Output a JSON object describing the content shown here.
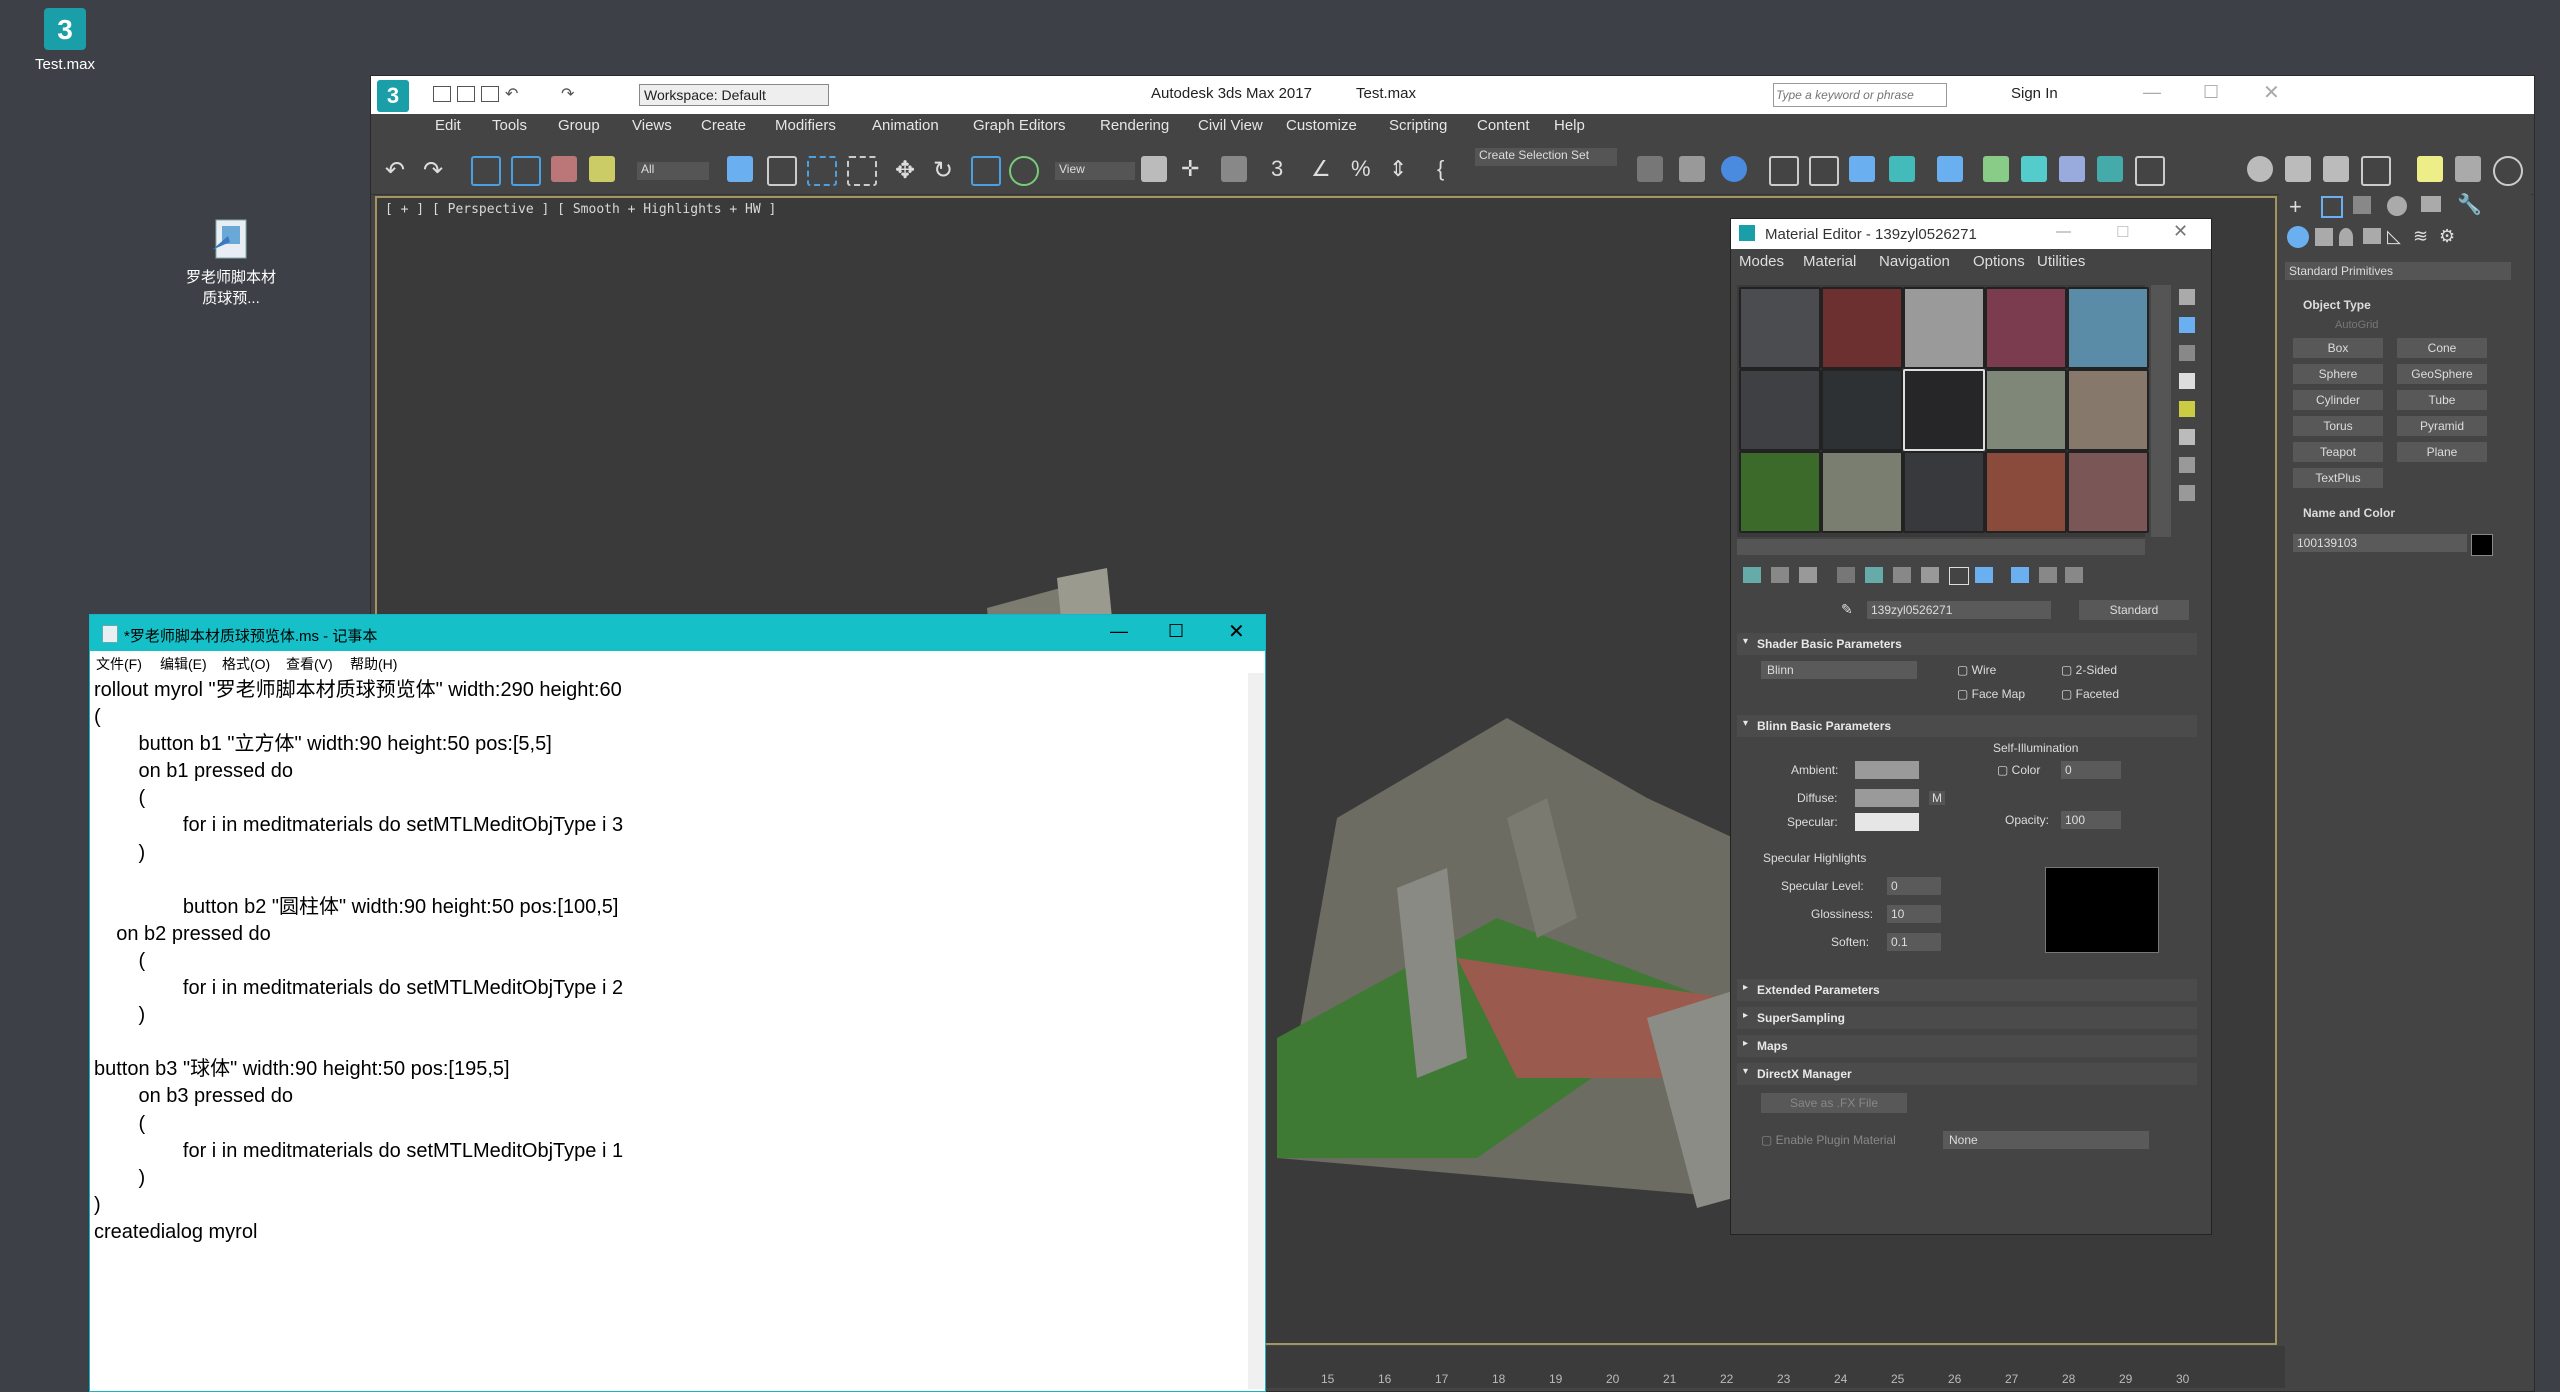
{
  "desktop": {
    "icons": [
      {
        "label": "Test.max"
      },
      {
        "label": "罗老师脚本材质球预..."
      }
    ]
  },
  "max_window": {
    "app_title": "Autodesk 3ds Max 2017",
    "file_name": "Test.max",
    "workspace": "Workspace: Default",
    "search_placeholder": "Type a keyword or phrase",
    "sign_in": "Sign In",
    "menu": [
      "Edit",
      "Tools",
      "Group",
      "Views",
      "Create",
      "Modifiers",
      "Animation",
      "Graph Editors",
      "Rendering",
      "Civil View",
      "Customize",
      "Scripting",
      "Content",
      "Help"
    ],
    "filter_dropdown": "All",
    "view_dropdown": "View",
    "selection_set": "Create Selection Set",
    "viewport_label": "[ + ] [ Perspective ] [ Smooth + Highlights + HW ]",
    "timeline_ticks": [
      "15",
      "16",
      "17",
      "18",
      "19",
      "20",
      "21",
      "22",
      "23",
      "24",
      "25",
      "26",
      "27",
      "28",
      "29",
      "30"
    ]
  },
  "command_panel": {
    "category": "Standard Primitives",
    "object_type_title": "Object Type",
    "autogrid": "AutoGrid",
    "buttons": [
      "Box",
      "Cone",
      "Sphere",
      "GeoSphere",
      "Cylinder",
      "Tube",
      "Torus",
      "Pyramid",
      "Teapot",
      "Plane",
      "TextPlus"
    ],
    "name_color_title": "Name and Color",
    "object_name": "100139103"
  },
  "material_editor": {
    "title": "Material Editor - 139zyl0526271",
    "menu": [
      "Modes",
      "Material",
      "Navigation",
      "Options",
      "Utilities"
    ],
    "material_name": "139zyl0526271",
    "material_type": "Standard",
    "shader_rollout": "Shader Basic Parameters",
    "shader": "Blinn",
    "wire": "Wire",
    "two_sided": "2-Sided",
    "face_map": "Face Map",
    "faceted": "Faceted",
    "blinn_rollout": "Blinn Basic Parameters",
    "self_illum": "Self-Illumination",
    "ambient": "Ambient:",
    "diffuse": "Diffuse:",
    "specular": "Specular:",
    "color_label": "Color",
    "color_value": "0",
    "opacity_label": "Opacity:",
    "opacity_value": "100",
    "m_button": "M",
    "spec_highlights": "Specular Highlights",
    "spec_level_label": "Specular Level:",
    "spec_level": "0",
    "gloss_label": "Glossiness:",
    "gloss": "10",
    "soften_label": "Soften:",
    "soften": "0.1",
    "rollouts": [
      "Extended Parameters",
      "SuperSampling",
      "Maps",
      "DirectX Manager"
    ],
    "save_fx": "Save as .FX File",
    "enable_plugin": "Enable Plugin Material",
    "plugin_none": "None"
  },
  "notepad": {
    "title": "*罗老师脚本材质球预览体.ms - 记事本",
    "menu": [
      "文件(F)",
      "编辑(E)",
      "格式(O)",
      "查看(V)",
      "帮助(H)"
    ],
    "lines": [
      "rollout myrol \"罗老师脚本材质球预览体\" width:290 height:60",
      "(",
      "        button b1 \"立方体\" width:90 height:50 pos:[5,5]",
      "        on b1 pressed do",
      "        (",
      "                for i in meditmaterials do setMTLMeditObjType i 3",
      "        )",
      "",
      "                button b2 \"圆柱体\" width:90 height:50 pos:[100,5]",
      "    on b2 pressed do",
      "        (",
      "                for i in meditmaterials do setMTLMeditObjType i 2",
      "        )",
      "",
      "button b3 \"球体\" width:90 height:50 pos:[195,5]",
      "        on b3 pressed do",
      "        (",
      "                for i in meditmaterials do setMTLMeditObjType i 1",
      "        )",
      ")",
      "createdialog myrol"
    ]
  }
}
